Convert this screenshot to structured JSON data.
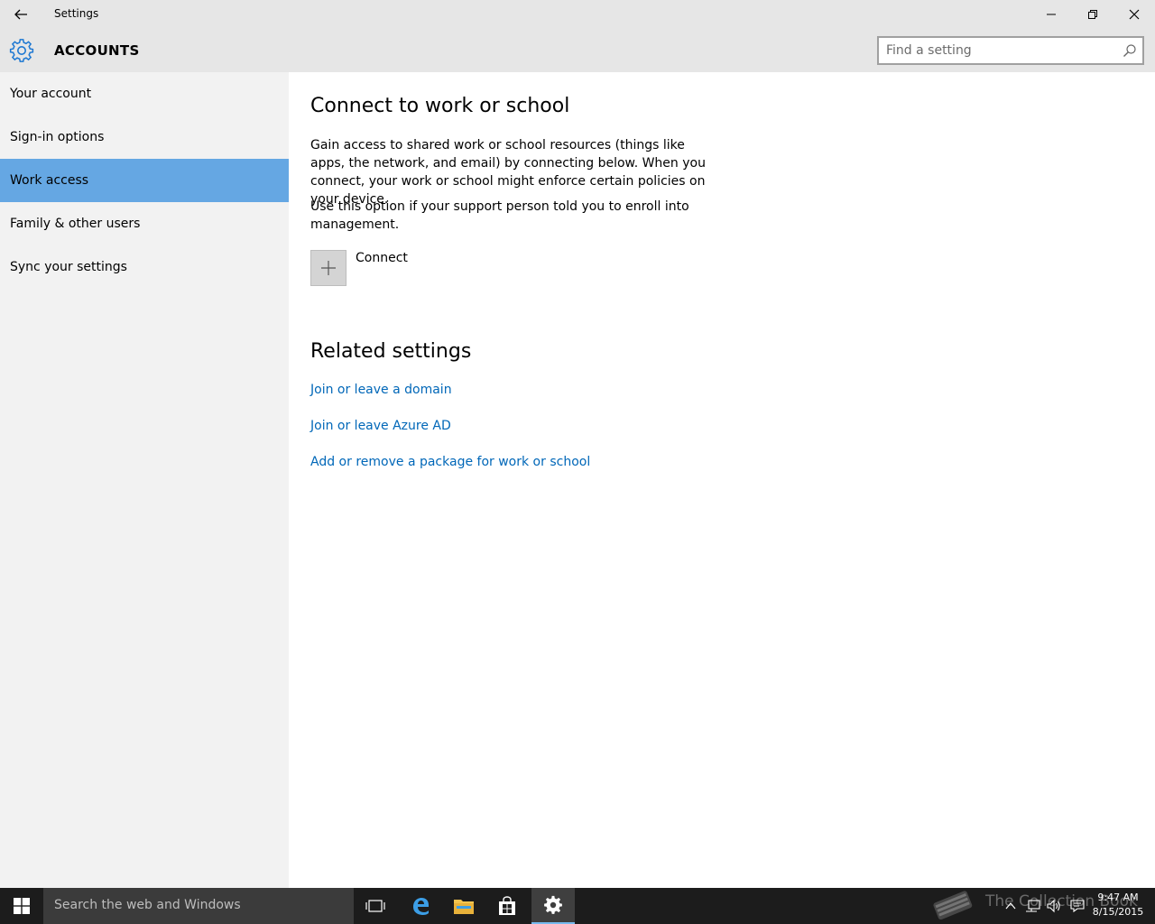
{
  "window": {
    "title": "Settings"
  },
  "header": {
    "section_title": "ACCOUNTS",
    "search_placeholder": "Find a setting"
  },
  "sidebar": {
    "items": [
      {
        "label": "Your account",
        "active": false
      },
      {
        "label": "Sign-in options",
        "active": false
      },
      {
        "label": "Work access",
        "active": true
      },
      {
        "label": "Family & other users",
        "active": false
      },
      {
        "label": "Sync your settings",
        "active": false
      }
    ]
  },
  "main": {
    "title": "Connect to work or school",
    "description": "Gain access to shared work or school resources (things like apps, the network, and email) by connecting below. When you connect, your work or school might enforce certain policies on your device.",
    "enroll_note": "Use this option if your support person told you to enroll into management.",
    "connect_label": "Connect",
    "related_title": "Related settings",
    "links": [
      "Join or leave a domain",
      "Join or leave Azure AD",
      "Add or remove a package for work or school"
    ]
  },
  "taskbar": {
    "search_placeholder": "Search the web and Windows",
    "time": "9:47 AM",
    "date": "8/15/2015",
    "watermark": "The Collection Book"
  },
  "colors": {
    "accent": "#65a7e3",
    "link": "#0067b8",
    "gear": "#1e78d2"
  }
}
